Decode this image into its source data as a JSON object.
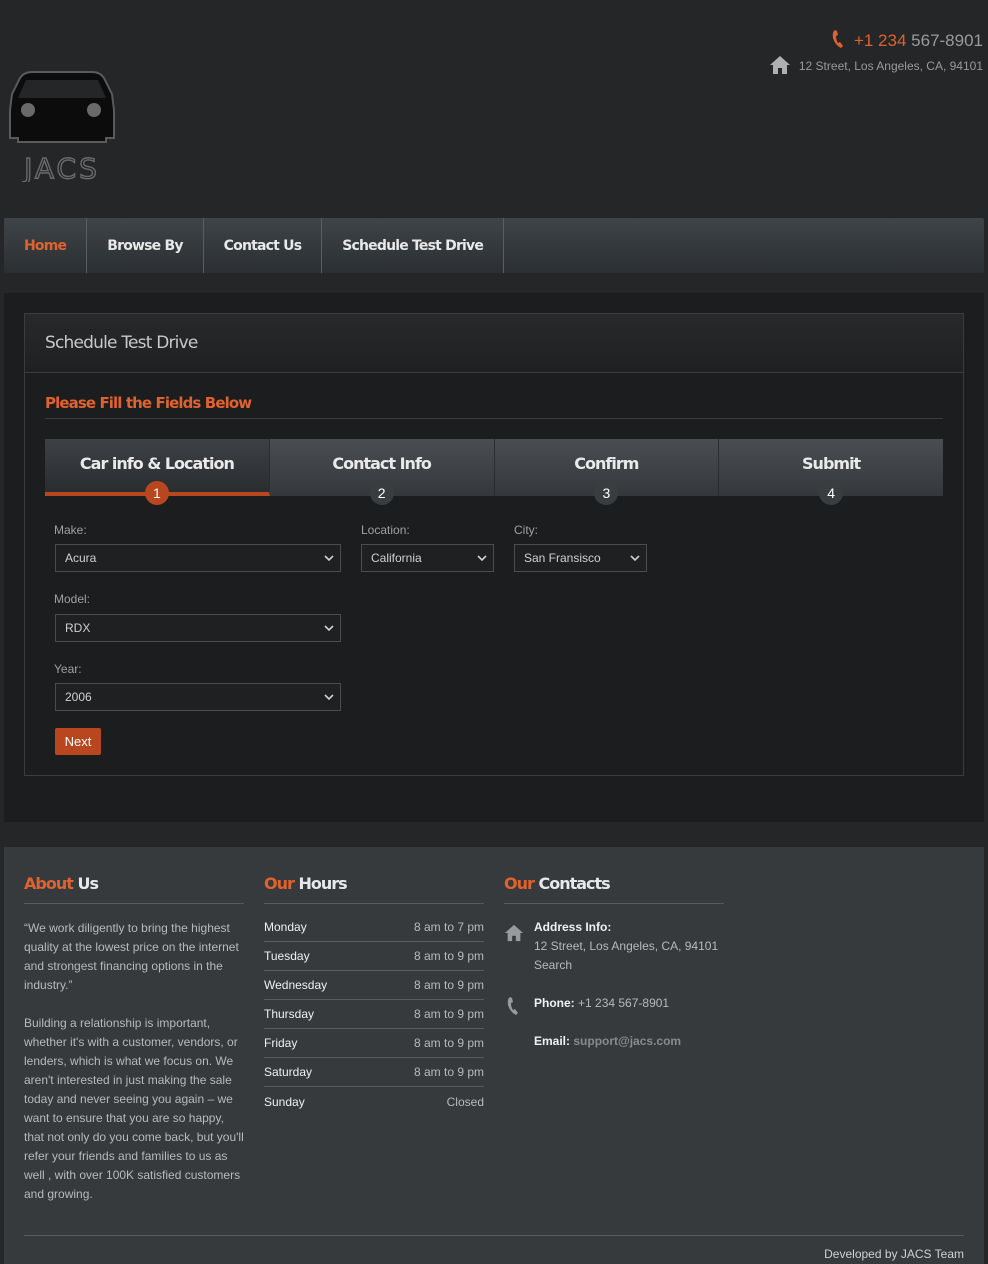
{
  "header": {
    "phone_code": "+1 234",
    "phone_rest": "567-8901",
    "address": "12 Street, Los Angeles, CA, 94101",
    "logo_text": "JACS"
  },
  "nav": {
    "items": [
      {
        "label": "Home"
      },
      {
        "label": "Browse By"
      },
      {
        "label": "Contact Us"
      },
      {
        "label": "Schedule Test Drive"
      }
    ]
  },
  "panel": {
    "title": "Schedule Test Drive",
    "subtitle": "Please Fill the Fields Below"
  },
  "steps": [
    {
      "label": "Car info & Location",
      "num": "1"
    },
    {
      "label": "Contact Info",
      "num": "2"
    },
    {
      "label": "Confirm",
      "num": "3"
    },
    {
      "label": "Submit",
      "num": "4"
    }
  ],
  "form": {
    "make_label": "Make:",
    "make_value": "Acura",
    "location_label": "Location:",
    "location_value": "California",
    "city_label": "City:",
    "city_value": "San Fransisco",
    "model_label": "Model:",
    "model_value": "RDX",
    "year_label": "Year:",
    "year_value": "2006",
    "next_label": "Next"
  },
  "footer": {
    "about_title_hl": "About",
    "about_title_rest": "Us",
    "about_p1": "“We work diligently to bring the highest quality at the lowest price on the internet and strongest financing options in the industry.”",
    "about_p2": "Building a relationship is important, whether it's with a customer, vendors, or lenders, which is what we focus on. We aren't interested in just making the sale today and never seeing you again – we want to ensure that you are so happy, that not only do you come back, but you'll refer your friends and families to us as well , with over 100K satisfied customers and growing.",
    "hours_title_hl": "Our",
    "hours_title_rest": "Hours",
    "hours": [
      {
        "day": "Monday",
        "time": "8 am to 7 pm"
      },
      {
        "day": "Tuesday",
        "time": "8 am to 9 pm"
      },
      {
        "day": "Wednesday",
        "time": "8 am to 9 pm"
      },
      {
        "day": "Thursday",
        "time": "8 am to 9 pm"
      },
      {
        "day": "Friday",
        "time": "8 am to 9 pm"
      },
      {
        "day": "Saturday",
        "time": "8 am to 9 pm"
      },
      {
        "day": "Sunday",
        "time": "Closed"
      }
    ],
    "contacts_title_hl": "Our",
    "contacts_title_rest": "Contacts",
    "address_label": "Address Info:",
    "address_line": "12 Street, Los Angeles, CA, 94101",
    "address_search": "Search",
    "phone_label": "Phone:",
    "phone_value": "+1 234 567-8901",
    "email_label": "Email:",
    "email_value": "support@jacs.com",
    "credit": "Developed by JACS Team"
  },
  "colors": {
    "accent": "#e0622e",
    "accent_dark": "#b8461e",
    "background": "#242628",
    "footer_bg": "#363a3d"
  }
}
